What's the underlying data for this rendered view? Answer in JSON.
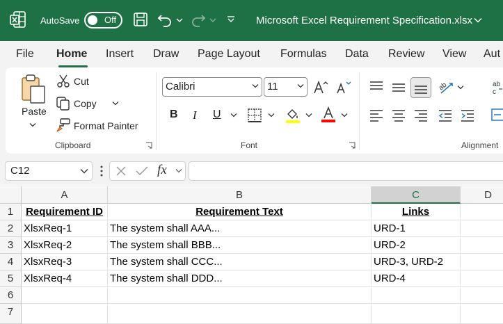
{
  "titlebar": {
    "autosave_label": "AutoSave",
    "toggle_state": "Off",
    "file_title": "Microsoft Excel Requirement Specification.xlsx",
    "bg_color": "#1e7145"
  },
  "tabs": [
    "File",
    "Home",
    "Insert",
    "Draw",
    "Page Layout",
    "Formulas",
    "Data",
    "Review",
    "View",
    "Aut"
  ],
  "active_tab": "Home",
  "ribbon": {
    "clipboard": {
      "paste_label": "Paste",
      "cut_label": "Cut",
      "copy_label": "Copy",
      "format_painter_label": "Format Painter",
      "group_label": "Clipboard"
    },
    "font": {
      "font_name": "Calibri",
      "font_size": "11",
      "group_label": "Font",
      "highlight_color": "#ffff00",
      "font_color": "#ff0000"
    },
    "alignment": {
      "group_label": "Alignment"
    }
  },
  "formula_bar": {
    "name_box": "C12",
    "fx": "fx",
    "formula": ""
  },
  "sheet": {
    "columns": [
      "A",
      "B",
      "C",
      "D"
    ],
    "selected_column": "C",
    "rows": [
      "1",
      "2",
      "3",
      "4",
      "5",
      "6",
      "7"
    ],
    "header": [
      "Requirement ID",
      "Requirement Text",
      "Links"
    ],
    "data": [
      [
        "XlsxReq-1",
        "The system shall AAA...",
        "URD-1"
      ],
      [
        "XlsxReq-2",
        "The system shall BBB...",
        "URD-2"
      ],
      [
        "XlsxReq-3",
        "The system shall CCC...",
        "URD-3, URD-2"
      ],
      [
        "XlsxReq-4",
        "The system shall DDD...",
        "URD-4"
      ]
    ]
  }
}
